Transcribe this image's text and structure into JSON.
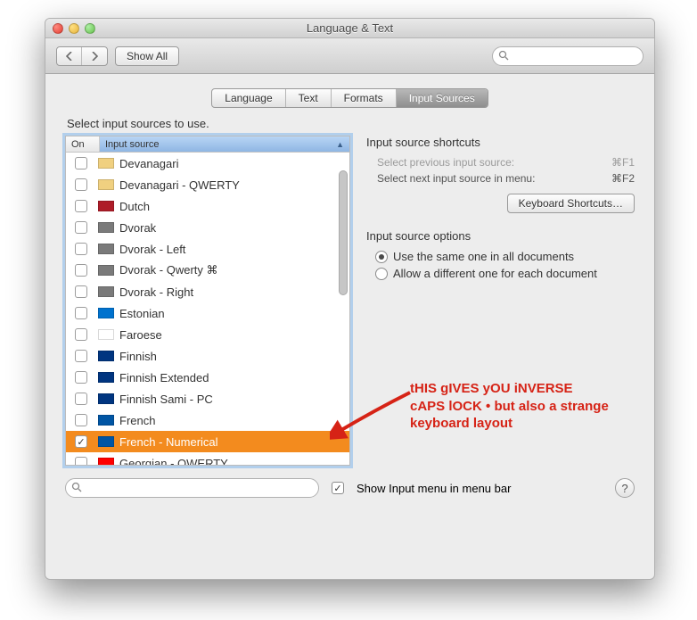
{
  "window": {
    "title": "Language & Text",
    "show_all": "Show All",
    "search_placeholder": ""
  },
  "tabs": [
    "Language",
    "Text",
    "Formats",
    "Input Sources"
  ],
  "active_tab": 3,
  "prompt": "Select input sources to use.",
  "list": {
    "col_on": "On",
    "col_src": "Input source",
    "items": [
      {
        "label": "Devanagari",
        "checked": false,
        "flag": "#f0d080",
        "selected": false
      },
      {
        "label": "Devanagari - QWERTY",
        "checked": false,
        "flag": "#f0d080",
        "selected": false
      },
      {
        "label": "Dutch",
        "checked": false,
        "flag": "#ae1c28",
        "selected": false
      },
      {
        "label": "Dvorak",
        "checked": false,
        "flag": "#7a7a7a",
        "selected": false
      },
      {
        "label": "Dvorak - Left",
        "checked": false,
        "flag": "#7a7a7a",
        "selected": false
      },
      {
        "label": "Dvorak - Qwerty ⌘",
        "checked": false,
        "flag": "#7a7a7a",
        "selected": false
      },
      {
        "label": "Dvorak - Right",
        "checked": false,
        "flag": "#7a7a7a",
        "selected": false
      },
      {
        "label": "Estonian",
        "checked": false,
        "flag": "#0072ce",
        "selected": false
      },
      {
        "label": "Faroese",
        "checked": false,
        "flag": "#ffffff",
        "selected": false
      },
      {
        "label": "Finnish",
        "checked": false,
        "flag": "#003580",
        "selected": false
      },
      {
        "label": "Finnish Extended",
        "checked": false,
        "flag": "#003580",
        "selected": false
      },
      {
        "label": "Finnish Sami - PC",
        "checked": false,
        "flag": "#003580",
        "selected": false
      },
      {
        "label": "French",
        "checked": false,
        "flag": "#0055a4",
        "selected": false
      },
      {
        "label": "French - Numerical",
        "checked": true,
        "flag": "#0055a4",
        "selected": true
      },
      {
        "label": "Georgian - QWERTY",
        "checked": false,
        "flag": "#ff0000",
        "selected": false
      }
    ]
  },
  "right": {
    "shortcuts_title": "Input source shortcuts",
    "prev_label": "Select previous input source:",
    "prev_sc": "⌘F1",
    "next_label": "Select next input source in menu:",
    "next_sc": "⌘F2",
    "kbd_btn": "Keyboard Shortcuts…",
    "options_title": "Input source options",
    "opt_same": "Use the same one in all documents",
    "opt_diff": "Allow a different one for each document",
    "selected_option": 0
  },
  "bottom": {
    "show_menu": "Show Input menu in menu bar",
    "show_menu_checked": true
  },
  "annotation": {
    "line1": "tHIS gIVES yOU iNVERSE",
    "line2": "cAPS lOCK • but also a strange",
    "line3": "keyboard layout"
  }
}
